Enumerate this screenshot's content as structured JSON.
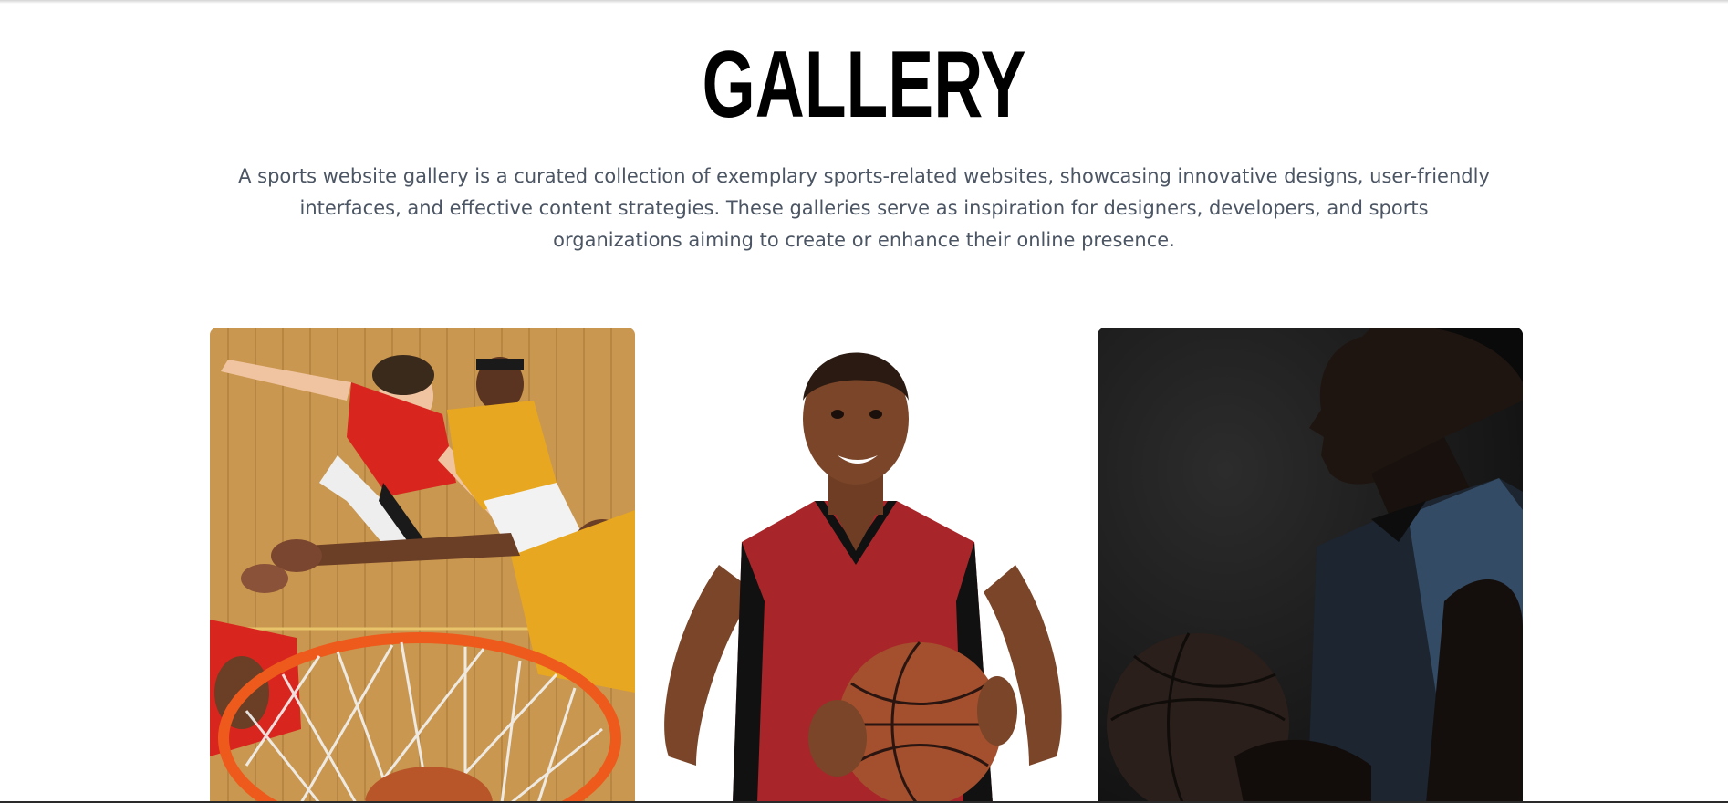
{
  "gallery": {
    "title": "GALLERY",
    "description": "A sports website gallery is a curated collection of exemplary sports-related websites, showcasing innovative designs, user-friendly interfaces, and effective content strategies. These galleries serve as inspiration for designers, developers, and sports organizations aiming to create or enhance their online presence."
  },
  "images": [
    {
      "name": "basketball-players-rebound-photo"
    },
    {
      "name": "player-holding-basketball-photo"
    },
    {
      "name": "player-profile-dark-photo"
    }
  ],
  "colors": {
    "title": "#000000",
    "description": "#4b5563",
    "background": "#ffffff"
  }
}
